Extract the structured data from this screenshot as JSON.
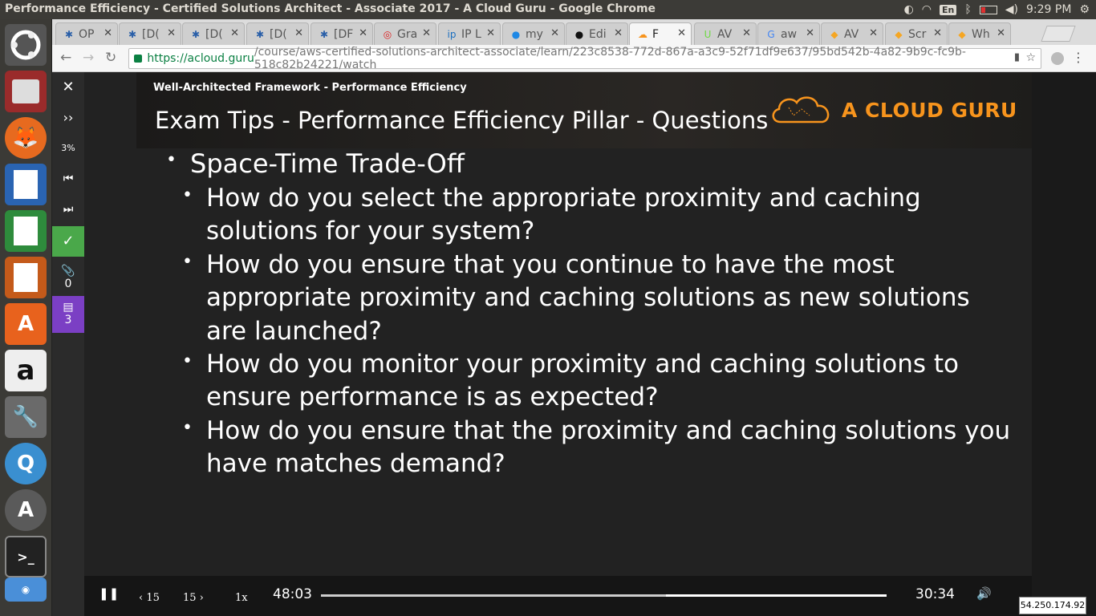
{
  "window": {
    "title": "Performance Efficiency - Certified Solutions Architect - Associate 2017 - A Cloud Guru - Google Chrome",
    "time": "9:29 PM",
    "lang": "En"
  },
  "tabs": [
    {
      "label": "OP",
      "icon": "tool-icon"
    },
    {
      "label": "[D(",
      "icon": "tool-icon"
    },
    {
      "label": "[D(",
      "icon": "tool-icon"
    },
    {
      "label": "[D(",
      "icon": "tool-icon"
    },
    {
      "label": "[DF",
      "icon": "tool-icon"
    },
    {
      "label": "Gra",
      "icon": "opera-icon"
    },
    {
      "label": "IP L",
      "icon": "ip-icon"
    },
    {
      "label": "my",
      "icon": "db-icon"
    },
    {
      "label": "Edi",
      "icon": "github-icon"
    },
    {
      "label": "F",
      "icon": "cloud-icon"
    },
    {
      "label": "AV",
      "icon": "upwork-icon"
    },
    {
      "label": "aw",
      "icon": "google-icon"
    },
    {
      "label": "AV",
      "icon": "aws-icon"
    },
    {
      "label": "Scr",
      "icon": "aws-icon"
    },
    {
      "label": "Wh",
      "icon": "aws-icon"
    }
  ],
  "address": {
    "host": "https://acloud.guru",
    "path": "/course/aws-certified-solutions-architect-associate/learn/223c8538-772d-867a-a3c9-52f71df9e637/95bd542b-4a82-9b9c-fc9b-518c82b24221/watch"
  },
  "sidebar": {
    "close": "✕",
    "expand": "››",
    "progress": "3%",
    "prev": "⏮",
    "next": "⏭",
    "done": "✓",
    "attach_count": "0",
    "comment_count": "3"
  },
  "slide": {
    "kicker": "Well-Architected Framework - Performance Efficiency",
    "title": "Exam Tips - Performance Efficiency Pillar - Questions",
    "brand": "A CLOUD GURU",
    "heading": "Space-Time Trade-Off",
    "bullets": [
      [
        "How do you select the appropriate proximity and caching",
        "solutions for your system?"
      ],
      [
        "How do you ensure that you continue to have the most",
        "appropriate proximity and caching solutions as new solutions",
        "are launched?"
      ],
      [
        "How do you monitor your proximity and caching solutions to",
        "ensure performance is as expected?"
      ],
      [
        "How do you ensure that the proximity and caching solutions you",
        "have matches demand?"
      ]
    ]
  },
  "player": {
    "back": "15",
    "forward": "15",
    "speed": "1x",
    "elapsed": "48:03",
    "remaining": "30:34",
    "progress": 0.61
  },
  "overlay": {
    "ip": "54.250.174.92"
  }
}
